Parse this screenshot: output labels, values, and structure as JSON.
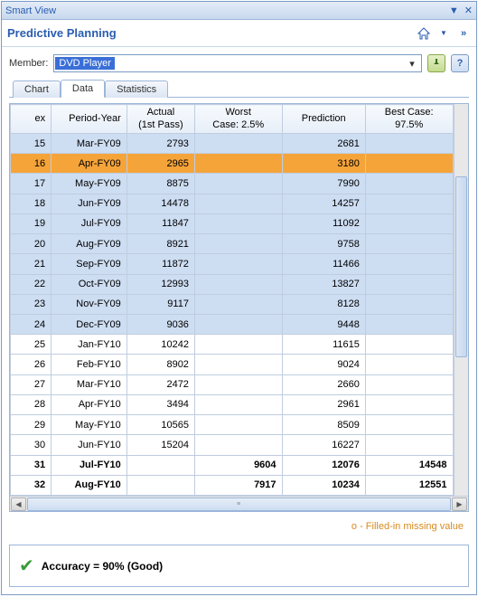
{
  "titlebar": {
    "title": "Smart View"
  },
  "header": {
    "title": "Predictive Planning"
  },
  "member": {
    "label": "Member:",
    "value": "DVD Player"
  },
  "tabs": [
    {
      "label": "Chart"
    },
    {
      "label": "Data"
    },
    {
      "label": "Statistics"
    }
  ],
  "columns": {
    "index": "ex",
    "period": "Period-Year",
    "actual": "Actual\n(1st Pass)",
    "worst": "Worst\nCase: 2.5%",
    "prediction": "Prediction",
    "best": "Best Case:\n97.5%"
  },
  "rows": [
    {
      "idx": "15",
      "period": "Mar-FY09",
      "actual": "2793",
      "worst": "",
      "pred": "2681",
      "best": "",
      "cls": "blue"
    },
    {
      "idx": "16",
      "period": "Apr-FY09",
      "actual": "2965",
      "worst": "",
      "pred": "3180",
      "best": "",
      "cls": "orange"
    },
    {
      "idx": "17",
      "period": "May-FY09",
      "actual": "8875",
      "worst": "",
      "pred": "7990",
      "best": "",
      "cls": "blue"
    },
    {
      "idx": "18",
      "period": "Jun-FY09",
      "actual": "14478",
      "worst": "",
      "pred": "14257",
      "best": "",
      "cls": "blue"
    },
    {
      "idx": "19",
      "period": "Jul-FY09",
      "actual": "11847",
      "worst": "",
      "pred": "11092",
      "best": "",
      "cls": "blue"
    },
    {
      "idx": "20",
      "period": "Aug-FY09",
      "actual": "8921",
      "worst": "",
      "pred": "9758",
      "best": "",
      "cls": "blue"
    },
    {
      "idx": "21",
      "period": "Sep-FY09",
      "actual": "11872",
      "worst": "",
      "pred": "11466",
      "best": "",
      "cls": "blue"
    },
    {
      "idx": "22",
      "period": "Oct-FY09",
      "actual": "12993",
      "worst": "",
      "pred": "13827",
      "best": "",
      "cls": "blue"
    },
    {
      "idx": "23",
      "period": "Nov-FY09",
      "actual": "9117",
      "worst": "",
      "pred": "8128",
      "best": "",
      "cls": "blue"
    },
    {
      "idx": "24",
      "period": "Dec-FY09",
      "actual": "9036",
      "worst": "",
      "pred": "9448",
      "best": "",
      "cls": "blue"
    },
    {
      "idx": "25",
      "period": "Jan-FY10",
      "actual": "10242",
      "worst": "",
      "pred": "11615",
      "best": "",
      "cls": "white"
    },
    {
      "idx": "26",
      "period": "Feb-FY10",
      "actual": "8902",
      "worst": "",
      "pred": "9024",
      "best": "",
      "cls": "white"
    },
    {
      "idx": "27",
      "period": "Mar-FY10",
      "actual": "2472",
      "worst": "",
      "pred": "2660",
      "best": "",
      "cls": "white"
    },
    {
      "idx": "28",
      "period": "Apr-FY10",
      "actual": "3494",
      "worst": "",
      "pred": "2961",
      "best": "",
      "cls": "white"
    },
    {
      "idx": "29",
      "period": "May-FY10",
      "actual": "10565",
      "worst": "",
      "pred": "8509",
      "best": "",
      "cls": "white"
    },
    {
      "idx": "30",
      "period": "Jun-FY10",
      "actual": "15204",
      "worst": "",
      "pred": "16227",
      "best": "",
      "cls": "white"
    },
    {
      "idx": "31",
      "period": "Jul-FY10",
      "actual": "",
      "worst": "9604",
      "pred": "12076",
      "best": "14548",
      "cls": "white bold"
    },
    {
      "idx": "32",
      "period": "Aug-FY10",
      "actual": "",
      "worst": "7917",
      "pred": "10234",
      "best": "12551",
      "cls": "white bold"
    }
  ],
  "legend": "o - Filled-in missing value",
  "accuracy": {
    "text": "Accuracy = 90% (Good)"
  }
}
